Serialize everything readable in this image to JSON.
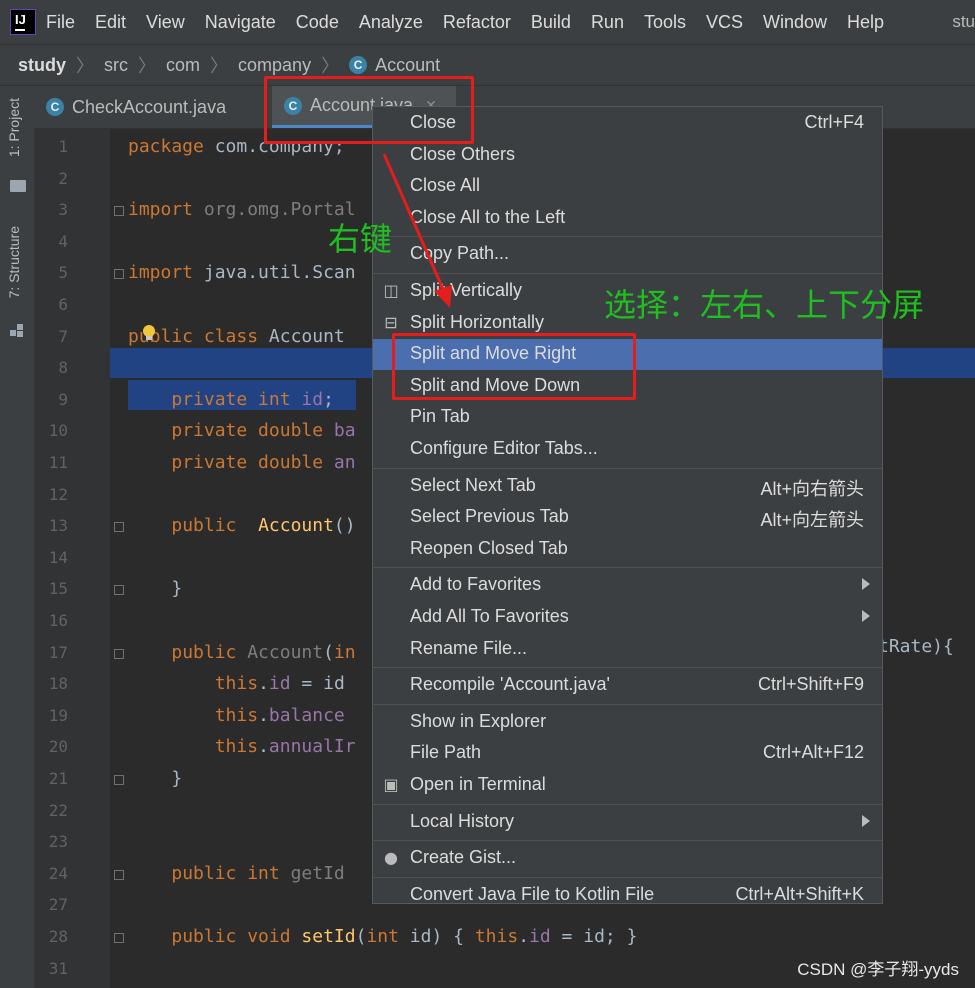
{
  "menubar": {
    "items": [
      "File",
      "Edit",
      "View",
      "Navigate",
      "Code",
      "Analyze",
      "Refactor",
      "Build",
      "Run",
      "Tools",
      "VCS",
      "Window",
      "Help"
    ],
    "right_text": "stu"
  },
  "breadcrumb": {
    "items": [
      "study",
      "src",
      "com",
      "company",
      "Account"
    ]
  },
  "toolstrip": {
    "project": "1: Project",
    "structure": "7: Structure"
  },
  "tabs": [
    {
      "label": "CheckAccount.java",
      "icon": "C"
    },
    {
      "label": "Account.java",
      "icon": "C"
    }
  ],
  "code": {
    "lines": [
      {
        "n": "1",
        "segs": [
          [
            "kw",
            "package "
          ],
          [
            "t",
            "com.company;"
          ]
        ]
      },
      {
        "n": "2",
        "segs": []
      },
      {
        "n": "3",
        "segs": [
          [
            "kw",
            "import "
          ],
          [
            "dim",
            "org.omg.Portal"
          ]
        ]
      },
      {
        "n": "4",
        "segs": []
      },
      {
        "n": "5",
        "segs": [
          [
            "kw",
            "import "
          ],
          [
            "t",
            "java.util.Scan"
          ]
        ]
      },
      {
        "n": "6",
        "segs": []
      },
      {
        "n": "7",
        "segs": [
          [
            "kw",
            "public class "
          ],
          [
            "t",
            "Account "
          ]
        ]
      },
      {
        "n": "8",
        "segs": []
      },
      {
        "n": "9",
        "segs": [
          [
            "t",
            "    "
          ],
          [
            "kw",
            "private int "
          ],
          [
            "fld",
            "id"
          ],
          [
            "t",
            ";"
          ]
        ]
      },
      {
        "n": "10",
        "segs": [
          [
            "t",
            "    "
          ],
          [
            "kw",
            "private double "
          ],
          [
            "fld",
            "ba"
          ]
        ]
      },
      {
        "n": "11",
        "segs": [
          [
            "t",
            "    "
          ],
          [
            "kw",
            "private double "
          ],
          [
            "fld",
            "an"
          ]
        ]
      },
      {
        "n": "12",
        "segs": []
      },
      {
        "n": "13",
        "segs": [
          [
            "t",
            "    "
          ],
          [
            "kw",
            "public  "
          ],
          [
            "fn",
            "Account"
          ],
          [
            "t",
            "()"
          ]
        ]
      },
      {
        "n": "14",
        "segs": []
      },
      {
        "n": "15",
        "segs": [
          [
            "t",
            "    }"
          ]
        ]
      },
      {
        "n": "16",
        "segs": []
      },
      {
        "n": "17",
        "segs": [
          [
            "t",
            "    "
          ],
          [
            "kw",
            "public "
          ],
          [
            "dim",
            "Account"
          ],
          [
            "t",
            "("
          ],
          [
            "kw",
            "in"
          ]
        ]
      },
      {
        "n": "18",
        "segs": [
          [
            "t",
            "        "
          ],
          [
            "kw",
            "this"
          ],
          [
            "t",
            "."
          ],
          [
            "fld",
            "id"
          ],
          [
            "t",
            " = id"
          ]
        ]
      },
      {
        "n": "19",
        "segs": [
          [
            "t",
            "        "
          ],
          [
            "kw",
            "this"
          ],
          [
            "t",
            "."
          ],
          [
            "fld",
            "balance"
          ]
        ]
      },
      {
        "n": "20",
        "segs": [
          [
            "t",
            "        "
          ],
          [
            "kw",
            "this"
          ],
          [
            "t",
            "."
          ],
          [
            "fld",
            "annualIr"
          ]
        ]
      },
      {
        "n": "21",
        "segs": [
          [
            "t",
            "    }"
          ]
        ]
      },
      {
        "n": "22",
        "segs": []
      },
      {
        "n": "23",
        "segs": []
      },
      {
        "n": "24",
        "segs": [
          [
            "t",
            "    "
          ],
          [
            "kw",
            "public int "
          ],
          [
            "dim",
            "getId"
          ]
        ]
      },
      {
        "n": "27",
        "segs": []
      },
      {
        "n": "28",
        "segs": [
          [
            "t",
            "    "
          ],
          [
            "kw",
            "public void "
          ],
          [
            "fn",
            "setId"
          ],
          [
            "t",
            "("
          ],
          [
            "kw",
            "int "
          ],
          [
            "t",
            "id) { "
          ],
          [
            "kw",
            "this"
          ],
          [
            "t",
            "."
          ],
          [
            "fld",
            "id"
          ],
          [
            "t",
            " = id; }"
          ]
        ]
      },
      {
        "n": "31",
        "segs": []
      }
    ],
    "line17_tail": "tRate){"
  },
  "context_menu": {
    "items": [
      {
        "label": "Close",
        "shortcut": "Ctrl+F4"
      },
      {
        "label": "Close Others"
      },
      {
        "label": "Close All"
      },
      {
        "label": "Close All to the Left"
      },
      {
        "sep": true
      },
      {
        "label": "Copy Path..."
      },
      {
        "sep": true
      },
      {
        "label": "Split Vertically",
        "icon": "split-vertically-icon"
      },
      {
        "label": "Split Horizontally",
        "icon": "split-horizontally-icon"
      },
      {
        "label": "Split and Move Right",
        "highlight": true
      },
      {
        "label": "Split and Move Down"
      },
      {
        "label": "Pin Tab"
      },
      {
        "label": "Configure Editor Tabs..."
      },
      {
        "sep": true
      },
      {
        "label": "Select Next Tab",
        "shortcut": "Alt+向右箭头"
      },
      {
        "label": "Select Previous Tab",
        "shortcut": "Alt+向左箭头"
      },
      {
        "label": "Reopen Closed Tab"
      },
      {
        "sep": true
      },
      {
        "label": "Add to Favorites",
        "submenu": true
      },
      {
        "label": "Add All To Favorites",
        "submenu": true
      },
      {
        "label": "Rename File..."
      },
      {
        "sep": true
      },
      {
        "label": "Recompile 'Account.java'",
        "shortcut": "Ctrl+Shift+F9"
      },
      {
        "sep": true
      },
      {
        "label": "Show in Explorer"
      },
      {
        "label": "File Path",
        "shortcut": "Ctrl+Alt+F12"
      },
      {
        "label": "Open in Terminal",
        "icon": "terminal-icon"
      },
      {
        "sep": true
      },
      {
        "label": "Local History",
        "submenu": true
      },
      {
        "sep": true
      },
      {
        "label": "Create Gist...",
        "icon": "github-icon"
      },
      {
        "sep": true
      },
      {
        "label": "Convert Java File to Kotlin File",
        "shortcut": "Ctrl+Alt+Shift+K"
      }
    ]
  },
  "annotations": {
    "right_click": "右键",
    "choose": "选择：左右、上下分屏"
  },
  "watermark": "CSDN @李子翔-yyds",
  "colors": {
    "accent": "#4b6eaf",
    "annotation_red": "#e41d1d",
    "annotation_green": "#1fbf1f"
  }
}
